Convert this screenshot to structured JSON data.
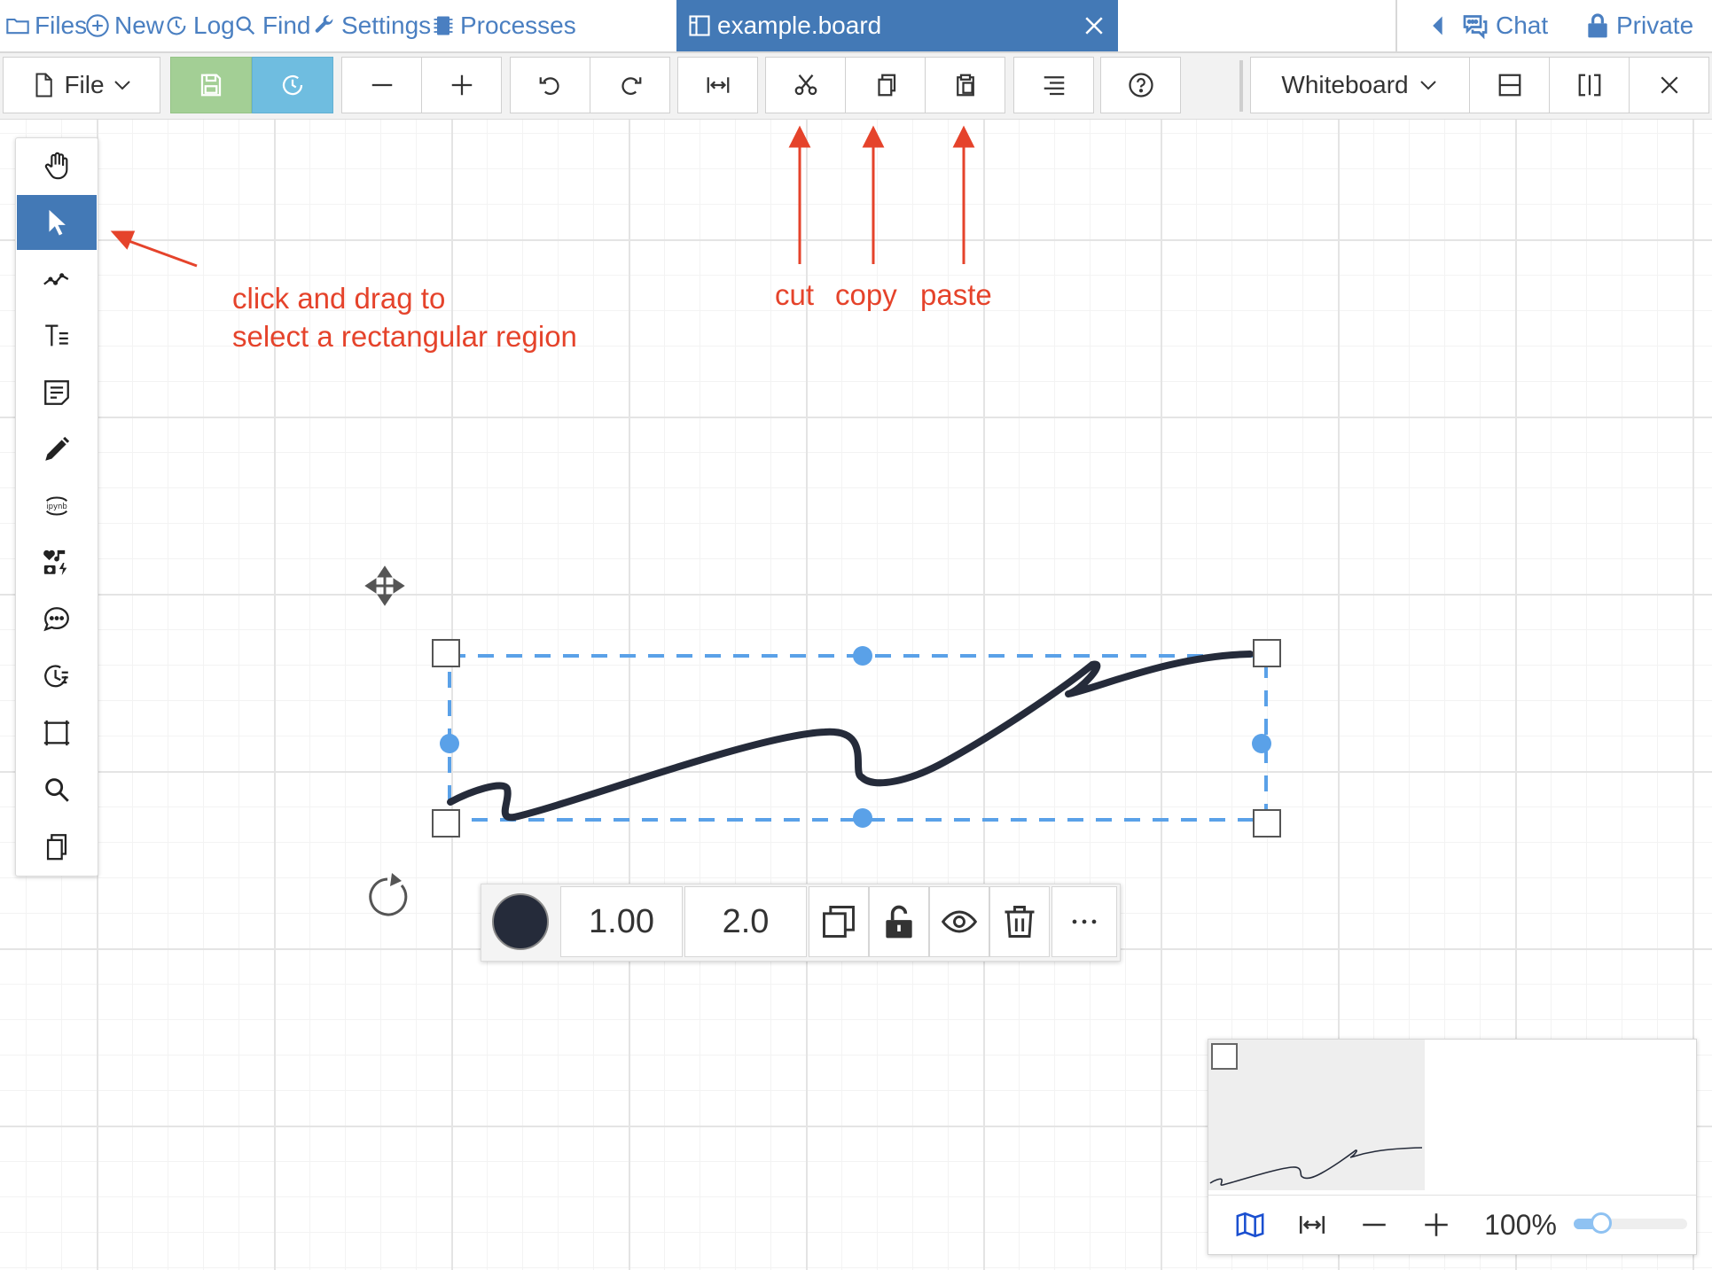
{
  "nav": {
    "links": [
      {
        "label": "Files",
        "icon": "folder-icon"
      },
      {
        "label": "New",
        "icon": "plus-circle-icon"
      },
      {
        "label": "Log",
        "icon": "history-icon"
      },
      {
        "label": "Find",
        "icon": "search-icon"
      },
      {
        "label": "Settings",
        "icon": "wrench-icon"
      },
      {
        "label": "Processes",
        "icon": "microchip-icon"
      }
    ],
    "active_tab": {
      "label": "example.board",
      "icon": "board-icon"
    },
    "chat_label": "Chat",
    "private_label": "Private"
  },
  "toolbar": {
    "file_label": "File",
    "editor_label": "Whiteboard"
  },
  "annotations": {
    "select_line1": "click and drag to",
    "select_line2": "select a rectangular region",
    "cut": "cut",
    "copy": "copy",
    "paste": "paste"
  },
  "properties": {
    "opacity": "1.00",
    "width": "2.0",
    "color": "#252b3a"
  },
  "minimap": {
    "zoom_label": "100%",
    "zoom_level": 0.18
  },
  "colors": {
    "accent": "#4379b6",
    "link": "#4a7fc1",
    "save_green": "#a3cf95",
    "timetravel_blue": "#6fbde0",
    "annotation_red": "#e5432b",
    "selection_blue": "#5aa1e8"
  }
}
